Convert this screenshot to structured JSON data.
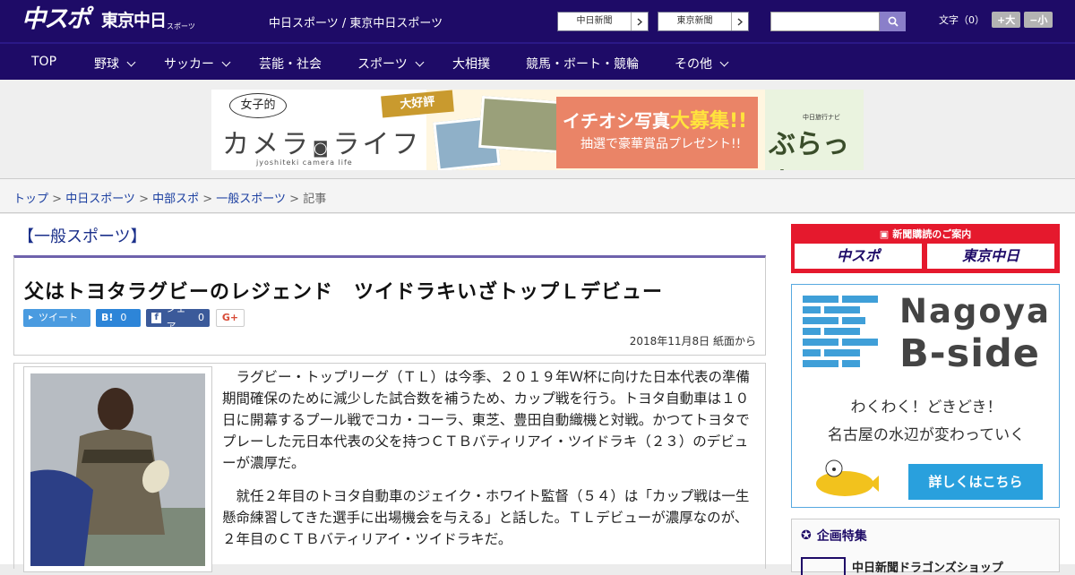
{
  "header": {
    "logo_main": "中スポ",
    "logo_sub": "東京中日",
    "logo_small": "スポーツ",
    "sites_label": "中日スポーツ / 東京中日スポーツ",
    "link1": "中日新聞",
    "link2": "東京新聞",
    "search_placeholder": "",
    "font_label": "文字（0）",
    "font_up": "+大",
    "font_down": "−小"
  },
  "nav": {
    "items": [
      "TOP",
      "野球",
      "サッカー",
      "芸能・社会",
      "スポーツ",
      "大相撲",
      "競馬・ボート・競輪",
      "その他"
    ]
  },
  "ad": {
    "joshi": "女子的",
    "camera": "カメラ",
    "life": "ライフ",
    "roman": "jyoshiteki camera life",
    "daikohyo": "大好評",
    "ichioshi": "イチオシ写真",
    "daiboshu": "大募集!!",
    "prize": "抽選で豪華賞品プレゼント!!",
    "navi": "中日旅行ナビ",
    "brand": "ぶらっ人"
  },
  "breadcrumb": {
    "items": [
      "トップ",
      "中日スポーツ",
      "中部スポ",
      "一般スポーツ"
    ],
    "current": "記事"
  },
  "article": {
    "category": "【一般スポーツ】",
    "title": "父はトヨタラグビーのレジェンド　ツイドラキいざトップＬデビュー",
    "tweet": "ツイート",
    "hatena_count": "0",
    "share": "シェア",
    "share_count": "0",
    "gplus": "G+",
    "date": "2018年11月8日 紙面から",
    "p1": "ラグビー・トップリーグ（ＴＬ）は今季、２０１９年Ｗ杯に向けた日本代表の準備期間確保のために減少した試合数を補うため、カップ戦を行う。トヨタ自動車は１０日に開幕するプール戦でコカ・コーラ、東芝、豊田自動織機と対戦。かつてトヨタでプレーした元日本代表の父を持つＣＴＢバティリアイ・ツイドラキ（２３）のデビューが濃厚だ。",
    "p2": "就任２年目のトヨタ自動車のジェイク・ホワイト監督（５４）は「カップ戦は一生懸命練習してきた選手に出場機会を与える」と話した。ＴＬデビューが濃厚なのが、２年目のＣＴＢバティリアイ・ツイドラキだ。"
  },
  "sidebar": {
    "subscribe_title": "新聞購読のご案内",
    "sub1": "中スポ",
    "sub2": "東京中日",
    "nb_line1": "Nagoya",
    "nb_line2": "B-side",
    "nb_copy1": "わくわく！どきどき！",
    "nb_copy2": "名古屋の水辺が変わっていく",
    "nb_button": "詳しくはこちら",
    "feature_title": "企画特集",
    "feature_item": "中日新聞ドラゴンズショップ"
  }
}
